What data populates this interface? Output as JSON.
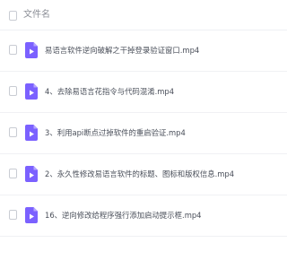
{
  "header": {
    "name_column_label": "文件名"
  },
  "colors": {
    "video_icon": "#7b61ff",
    "text": "#4a4f5a",
    "header_text": "#8c8f97"
  },
  "files": [
    {
      "name": "易语言软件逆向破解之干掉登录验证窗口.mp4",
      "icon": "video-file-icon"
    },
    {
      "name": "4、去除易语言花指令与代码混淆.mp4",
      "icon": "video-file-icon"
    },
    {
      "name": "3、利用api断点过掉软件的重启验证.mp4",
      "icon": "video-file-icon"
    },
    {
      "name": "2、永久性修改易语言软件的标题、图标和版权信息.mp4",
      "icon": "video-file-icon"
    },
    {
      "name": "16、逆向修改给程序强行添加启动提示框.mp4",
      "icon": "video-file-icon"
    }
  ]
}
